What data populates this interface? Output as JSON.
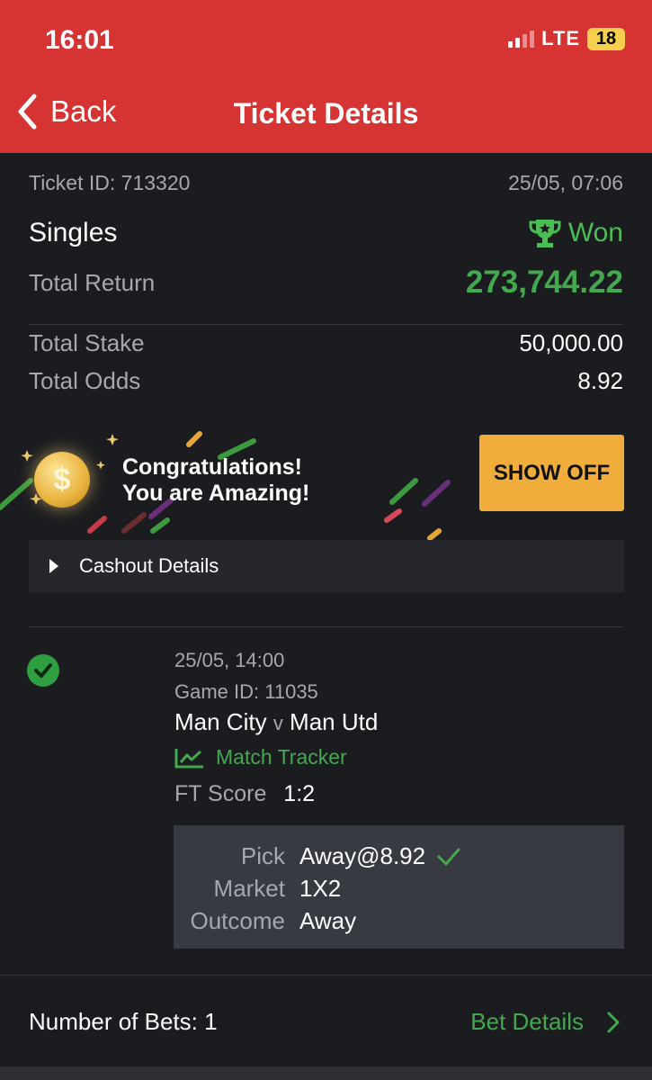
{
  "status": {
    "time": "16:01",
    "network": "LTE",
    "battery": "18"
  },
  "nav": {
    "back_label": "Back",
    "title": "Ticket Details"
  },
  "ticket": {
    "id_label": "Ticket ID: 713320",
    "datetime": "25/05, 07:06",
    "type": "Singles",
    "status": "Won",
    "total_return_label": "Total Return",
    "total_return": "273,744.22",
    "total_stake_label": "Total Stake",
    "total_stake": "50,000.00",
    "total_odds_label": "Total Odds",
    "total_odds": "8.92"
  },
  "banner": {
    "line1": "Congratulations!",
    "line2": "You are Amazing!",
    "button": "SHOW OFF",
    "coin_symbol": "$"
  },
  "cashout": {
    "label": "Cashout Details"
  },
  "bet": {
    "datetime": "25/05, 14:00",
    "game_id": "Game ID: 11035",
    "home": "Man City",
    "vs": "v",
    "away": "Man Utd",
    "tracker": "Match Tracker",
    "ft_label": "FT Score",
    "ft_score": "1:2",
    "pick_label": "Pick",
    "pick": "Away@8.92",
    "market_label": "Market",
    "market": "1X2",
    "outcome_label": "Outcome",
    "outcome": "Away"
  },
  "footer": {
    "num_bets": "Number of Bets: 1",
    "bet_details": "Bet Details"
  },
  "colors": {
    "header": "#d53433",
    "accent_green": "#44a84f",
    "show_off": "#f1ad3b",
    "background": "#1b1c20"
  },
  "icons": [
    "chevron-left-icon",
    "trophy-icon",
    "coin-icon",
    "caret-right-icon",
    "check-circle-icon",
    "chart-line-icon",
    "checkmark-icon",
    "chevron-right-icon"
  ]
}
